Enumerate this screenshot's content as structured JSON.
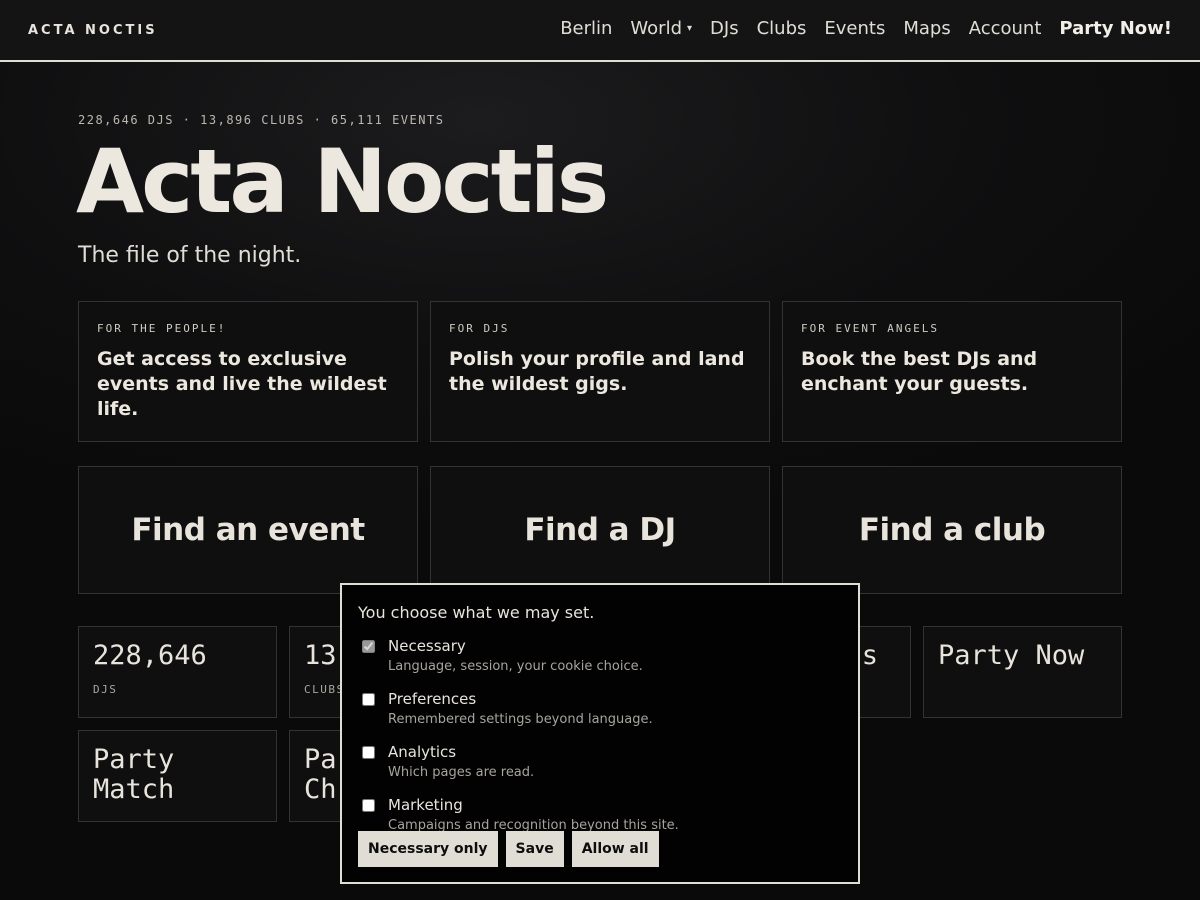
{
  "header": {
    "brand": "ACTA NOCTIS",
    "nav": [
      {
        "label": "Berlin",
        "strong": false,
        "caret": false
      },
      {
        "label": "World",
        "strong": false,
        "caret": true
      },
      {
        "label": "DJs",
        "strong": false,
        "caret": false
      },
      {
        "label": "Clubs",
        "strong": false,
        "caret": false
      },
      {
        "label": "Events",
        "strong": false,
        "caret": false
      },
      {
        "label": "Maps",
        "strong": false,
        "caret": false
      },
      {
        "label": "Account",
        "strong": false,
        "caret": false
      },
      {
        "label": "Party Now!",
        "strong": true,
        "caret": false
      }
    ]
  },
  "hero": {
    "stats": "228,646 DJS · 13,896 CLUBS · 65,111 EVENTS",
    "title": "Acta Noctis",
    "subtitle": "The file of the night."
  },
  "audience": [
    {
      "tag": "FOR THE PEOPLE!",
      "text": "Get access to exclusive events and live the wildest life."
    },
    {
      "tag": "FOR DJS",
      "text": "Polish your profile and land the wildest gigs."
    },
    {
      "tag": "FOR EVENT ANGELS",
      "text": "Book the best DJs and enchant your guests."
    }
  ],
  "find": [
    {
      "label": "Find an event"
    },
    {
      "label": "Find a DJ"
    },
    {
      "label": "Find a club"
    }
  ],
  "tiles": {
    "djs": {
      "value": "228,646",
      "label": "DJS"
    },
    "clubs": {
      "value": "13",
      "label": "CLUBS"
    },
    "partial": {
      "value": "s"
    },
    "party_now": {
      "value": "Party Now"
    },
    "party_match": {
      "value": "Party\nMatch"
    },
    "party_ch": {
      "value": "Pa\nCh"
    }
  },
  "consent": {
    "title": "You choose what we may set.",
    "options": [
      {
        "name": "Necessary",
        "desc": "Language, session, your cookie choice.",
        "checked": true,
        "disabled": true
      },
      {
        "name": "Preferences",
        "desc": "Remembered settings beyond language.",
        "checked": false,
        "disabled": false
      },
      {
        "name": "Analytics",
        "desc": "Which pages are read.",
        "checked": false,
        "disabled": false
      },
      {
        "name": "Marketing",
        "desc": "Campaigns and recognition beyond this site.",
        "checked": false,
        "disabled": false
      }
    ],
    "buttons": {
      "necessary_only": "Necessary only",
      "save": "Save",
      "allow_all": "Allow all"
    }
  }
}
